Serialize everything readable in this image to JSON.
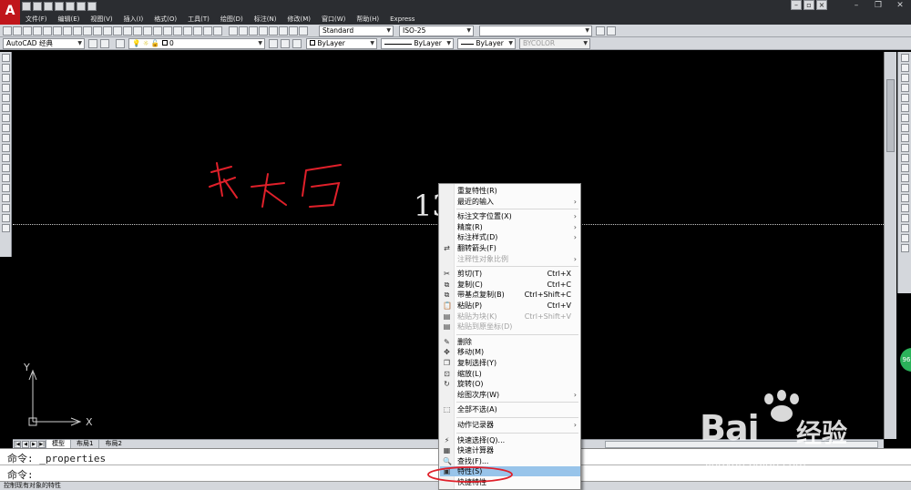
{
  "titlebar": {
    "menu": [
      "文件(F)",
      "编辑(E)",
      "视图(V)",
      "插入(I)",
      "格式(O)",
      "工具(T)",
      "绘图(D)",
      "标注(N)",
      "修改(M)",
      "窗口(W)",
      "帮助(H)",
      "Express"
    ],
    "logo": "A"
  },
  "toolbar1": {
    "text_style": "Standard",
    "dim_style": "ISO-25"
  },
  "toolbar2": {
    "workspace": "AutoCAD 经典",
    "layer": "0",
    "color": "ByLayer",
    "linetype": "ByLayer",
    "lineweight": "ByLayer",
    "plotstyle": "BYCOLOR"
  },
  "drawing": {
    "dimension_text": "13",
    "ucs_x": "X",
    "ucs_y": "Y"
  },
  "tabs": {
    "items": [
      "模型",
      "布局1",
      "布局2"
    ],
    "active_index": 0
  },
  "command": {
    "line1": "命令: _properties",
    "line2": "命令:"
  },
  "status": {
    "text": "控制现有对象的特性"
  },
  "context_menu": {
    "items": [
      {
        "label": "重复特性(R)",
        "icon": "",
        "shortcut": "",
        "submenu": false,
        "disabled": false
      },
      {
        "label": "最近的输入",
        "icon": "",
        "shortcut": "",
        "submenu": true,
        "disabled": false
      },
      {
        "label": "标注文字位置(X)",
        "icon": "",
        "shortcut": "",
        "submenu": true,
        "disabled": false
      },
      {
        "label": "精度(R)",
        "icon": "",
        "shortcut": "",
        "submenu": true,
        "disabled": false
      },
      {
        "label": "标注样式(D)",
        "icon": "",
        "shortcut": "",
        "submenu": true,
        "disabled": false
      },
      {
        "label": "翻转箭头(F)",
        "icon": "flip-arrow-icon",
        "shortcut": "",
        "submenu": false,
        "disabled": false
      },
      {
        "label": "注释性对象比例",
        "icon": "",
        "shortcut": "",
        "submenu": true,
        "disabled": true
      },
      {
        "label": "剪切(T)",
        "icon": "cut-icon",
        "shortcut": "Ctrl+X",
        "submenu": false,
        "disabled": false
      },
      {
        "label": "复制(C)",
        "icon": "copy-icon",
        "shortcut": "Ctrl+C",
        "submenu": false,
        "disabled": false
      },
      {
        "label": "带基点复制(B)",
        "icon": "copy-base-icon",
        "shortcut": "Ctrl+Shift+C",
        "submenu": false,
        "disabled": false
      },
      {
        "label": "粘贴(P)",
        "icon": "paste-icon",
        "shortcut": "Ctrl+V",
        "submenu": false,
        "disabled": false
      },
      {
        "label": "粘贴为块(K)",
        "icon": "paste-block-icon",
        "shortcut": "Ctrl+Shift+V",
        "submenu": false,
        "disabled": true
      },
      {
        "label": "粘贴到原坐标(D)",
        "icon": "paste-orig-icon",
        "shortcut": "",
        "submenu": false,
        "disabled": true
      },
      {
        "label": "删除",
        "icon": "erase-icon",
        "shortcut": "",
        "submenu": false,
        "disabled": false
      },
      {
        "label": "移动(M)",
        "icon": "move-icon",
        "shortcut": "",
        "submenu": false,
        "disabled": false
      },
      {
        "label": "复制选择(Y)",
        "icon": "copy-select-icon",
        "shortcut": "",
        "submenu": false,
        "disabled": false
      },
      {
        "label": "缩放(L)",
        "icon": "scale-icon",
        "shortcut": "",
        "submenu": false,
        "disabled": false
      },
      {
        "label": "旋转(O)",
        "icon": "rotate-icon",
        "shortcut": "",
        "submenu": false,
        "disabled": false
      },
      {
        "label": "绘图次序(W)",
        "icon": "",
        "shortcut": "",
        "submenu": true,
        "disabled": false
      },
      {
        "label": "全部不选(A)",
        "icon": "deselect-icon",
        "shortcut": "",
        "submenu": false,
        "disabled": false
      },
      {
        "label": "动作记录器",
        "icon": "",
        "shortcut": "",
        "submenu": true,
        "disabled": false
      },
      {
        "label": "快速选择(Q)...",
        "icon": "quick-select-icon",
        "shortcut": "",
        "submenu": false,
        "disabled": false
      },
      {
        "label": "快速计算器",
        "icon": "calculator-icon",
        "shortcut": "",
        "submenu": false,
        "disabled": false
      },
      {
        "label": "查找(F)...",
        "icon": "find-icon",
        "shortcut": "",
        "submenu": false,
        "disabled": false
      },
      {
        "label": "特性(S)",
        "icon": "properties-icon",
        "shortcut": "",
        "submenu": false,
        "disabled": false,
        "highlighted": true
      },
      {
        "label": "快捷特性",
        "icon": "",
        "shortcut": "",
        "submenu": false,
        "disabled": false
      }
    ]
  },
  "colors": {
    "menu_highlight": "#98c4ea",
    "annotation_red": "#e0202a",
    "canvas_bg": "#000000"
  },
  "floating_button": {
    "label": "96"
  },
  "watermark": {
    "brand": "Bai",
    "url": "jingyan.baidu.com"
  }
}
